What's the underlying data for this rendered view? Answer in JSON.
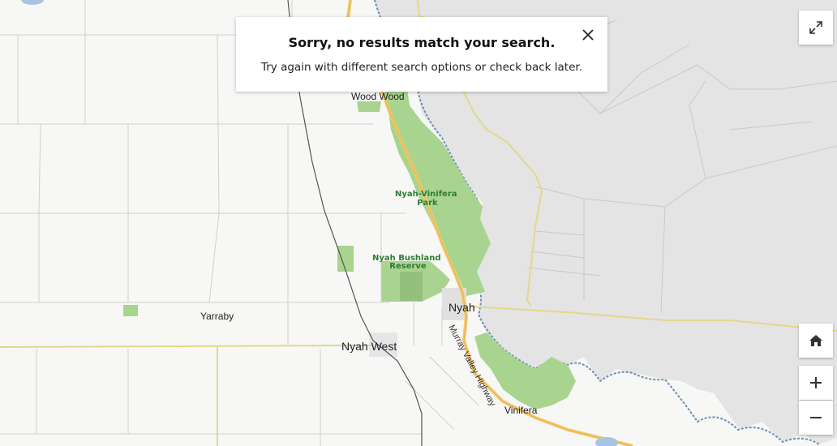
{
  "alert": {
    "title": "Sorry, no results match your search.",
    "message": "Try again with different search options or check back later."
  },
  "places": {
    "wood_wood": "Wood Wood",
    "nyah": "Nyah",
    "nyah_west": "Nyah West",
    "yarraby": "Yarraby",
    "vinifera": "Vinifera"
  },
  "parks": {
    "vinifera_park": [
      "Nyah-Vinifera",
      "Park"
    ],
    "bushland_reserve": [
      "Nyah Bushland",
      "Reserve"
    ]
  },
  "roads": {
    "murray_valley_highway": "Murray Valley Highway"
  },
  "controls": {
    "fullscreen_icon": "expand-icon",
    "home_icon": "home-icon",
    "zoom_in_icon": "plus-icon",
    "zoom_out_icon": "minus-icon"
  },
  "colors": {
    "park": "#a8d48f",
    "nsw_shade": "#e6e6e6",
    "major_road": "#f3c96a",
    "minor_road": "#e2d88a",
    "river": "#6b8fb5",
    "railway": "#555555",
    "town": "#cfcfcf"
  }
}
